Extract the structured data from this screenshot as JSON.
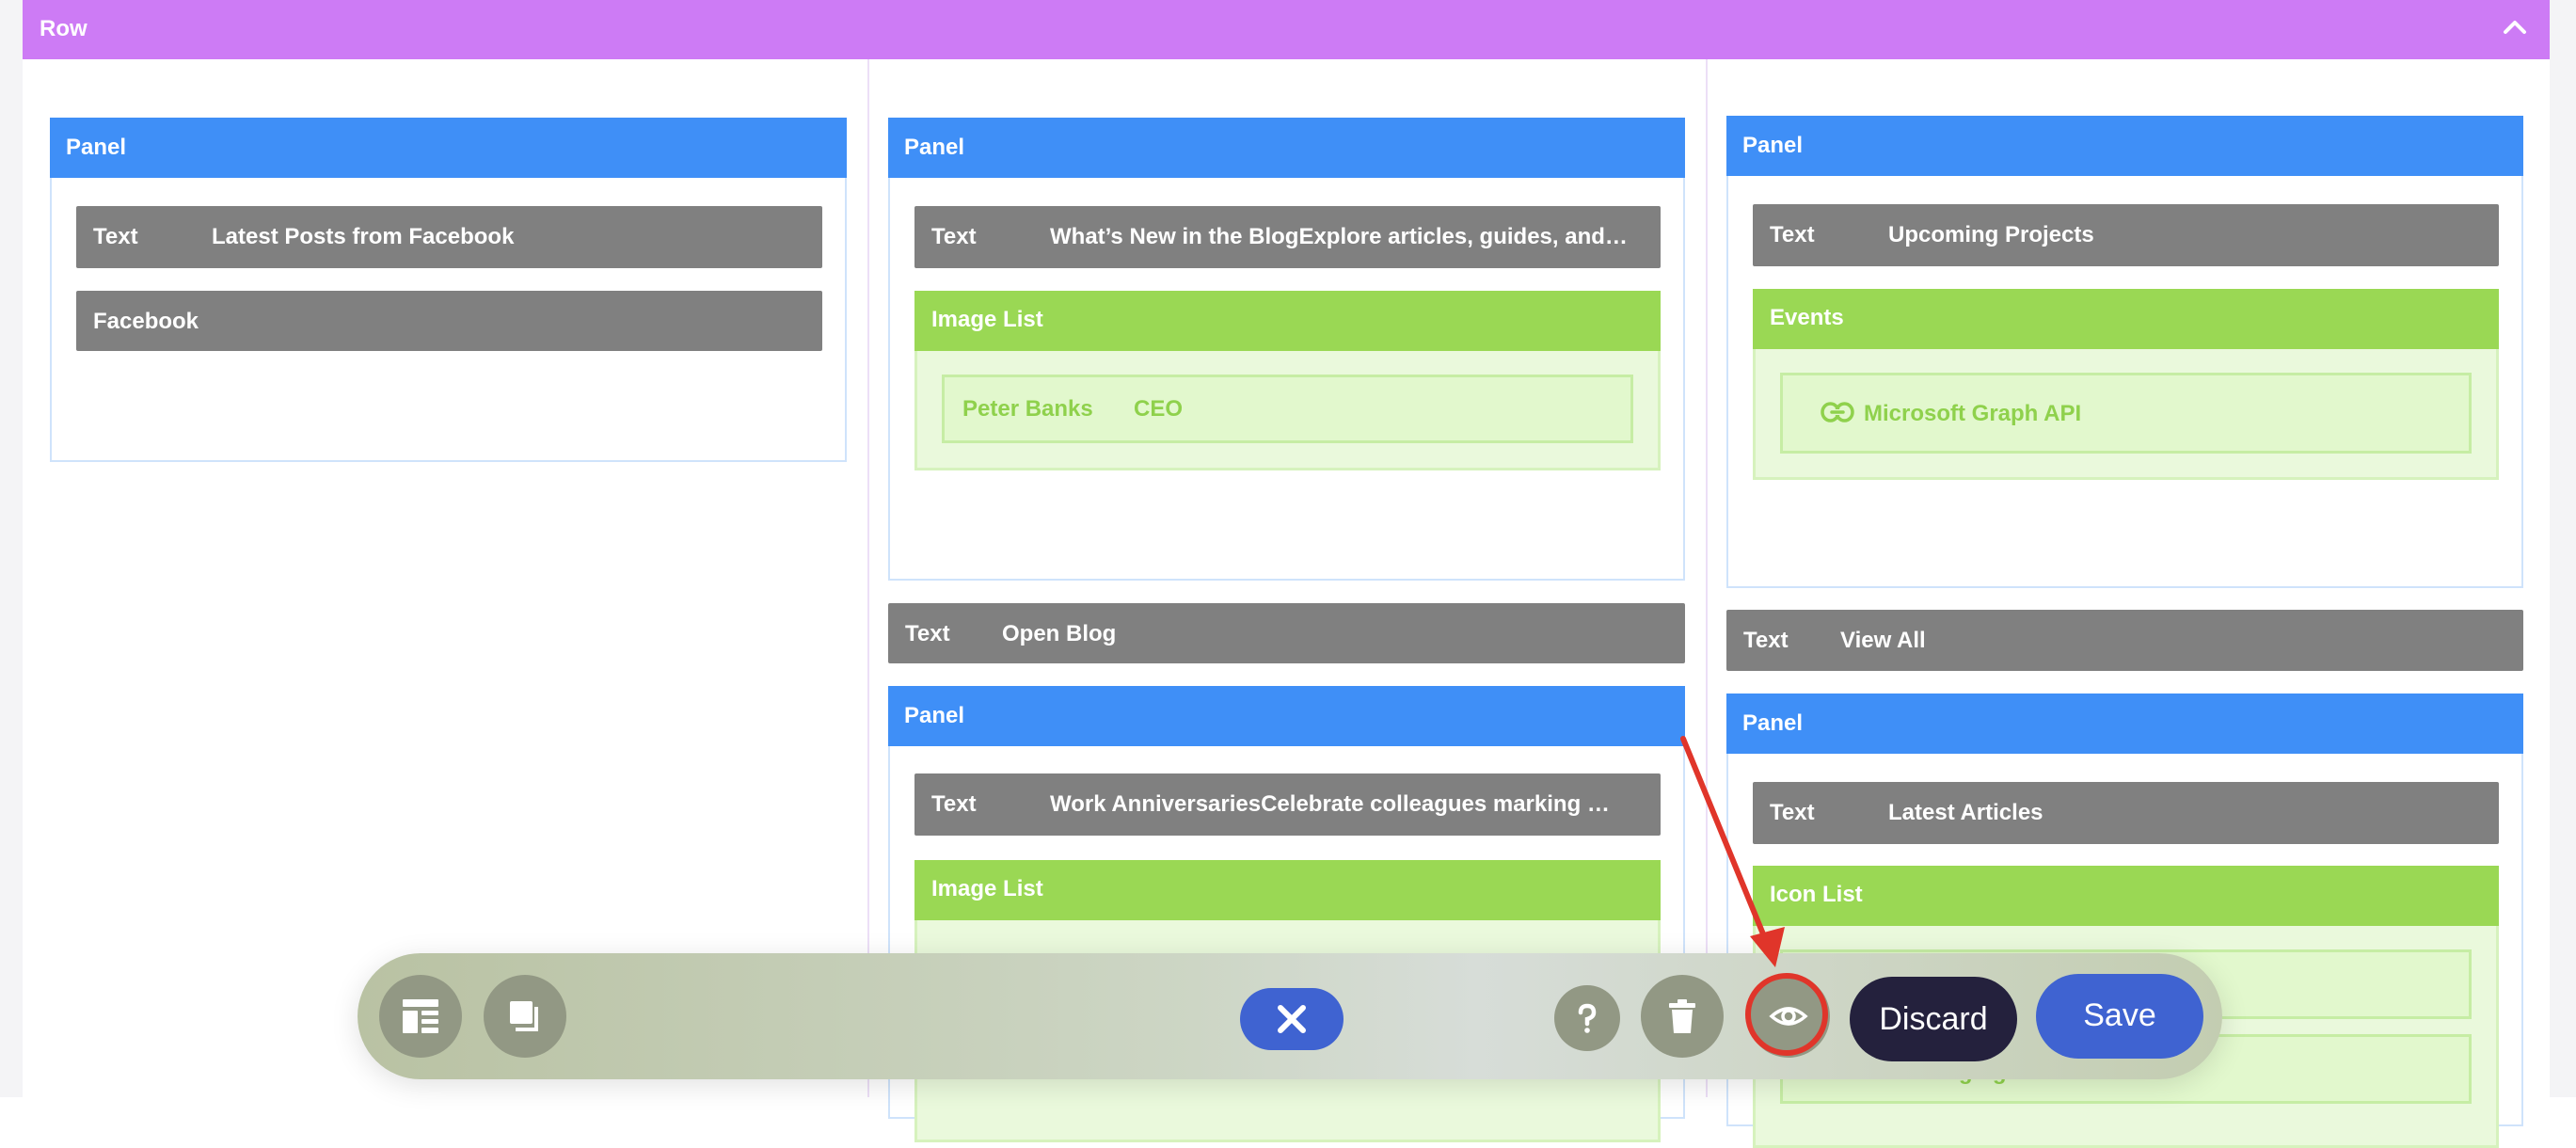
{
  "row": {
    "title": "Row"
  },
  "columns": {
    "left": {
      "panel_title": "Panel",
      "text_label": "Text",
      "text_value": "Latest Posts from Facebook",
      "facebook_label": "Facebook"
    },
    "middle": {
      "panel1_title": "Panel",
      "text1_label": "Text",
      "text1_value": "What’s New in the BlogExplore articles, guides, and…",
      "imagelist1_title": "Image List",
      "person_name": "Peter Banks",
      "person_role": "CEO",
      "open_blog_label": "Text",
      "open_blog_value": "Open Blog",
      "panel2_title": "Panel",
      "text2_label": "Text",
      "text2_value": "Work AnniversariesCelebrate colleagues marking …",
      "imagelist2_title": "Image List"
    },
    "right": {
      "panel1_title": "Panel",
      "text1_label": "Text",
      "text1_value": "Upcoming Projects",
      "events_title": "Events",
      "events_link": "Microsoft Graph API",
      "viewall_label": "Text",
      "viewall_value": "View All",
      "panel2_title": "Panel",
      "text2_label": "Text",
      "text2_value": "Latest Articles",
      "iconlist_title": "Icon List",
      "iconlist_item2": "Tools for Managing Tasks"
    }
  },
  "toolbar": {
    "discard_label": "Discard",
    "save_label": "Save",
    "icons": [
      "layout-icon",
      "layers-icon",
      "close-icon",
      "help-icon",
      "trash-icon",
      "eye-icon"
    ]
  },
  "colors": {
    "row": "#cd7bf5",
    "panel": "#3f8ff7",
    "text": "#808080",
    "green": "#9ad854",
    "primary_button": "#3f63d1",
    "dark_button": "#24213d",
    "highlight": "#e0352a"
  }
}
